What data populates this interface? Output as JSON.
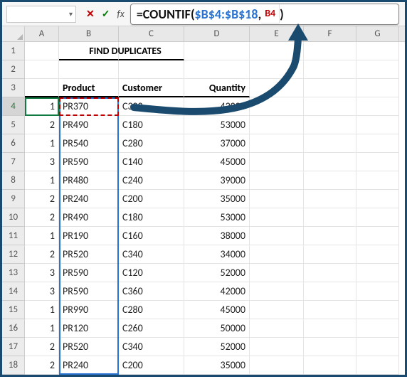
{
  "formula_bar": {
    "name_box_value": "",
    "cancel_glyph": "✕",
    "enter_glyph": "✓",
    "fx_label": "fx",
    "eq_fn": "=COUNTIF",
    "open_paren": "(",
    "range": "$B$4:$B$18",
    "comma": ", ",
    "cell_ref": "B4",
    "close_paren": ")"
  },
  "columns": {
    "A": "A",
    "B": "B",
    "C": "C",
    "D": "D",
    "E": "E",
    "F": "F",
    "G": "G"
  },
  "rownums": [
    "1",
    "2",
    "3",
    "4",
    "5",
    "6",
    "7",
    "8",
    "9",
    "10",
    "11",
    "12",
    "13",
    "14",
    "15",
    "16",
    "17",
    "18"
  ],
  "title": "FIND DUPLICATES",
  "headers": {
    "b": "Product",
    "c": "Customer",
    "d": "Quantity"
  },
  "rows": [
    {
      "a": "1",
      "b": "PR370",
      "c": "C300",
      "d": "43000"
    },
    {
      "a": "2",
      "b": "PR490",
      "c": "C180",
      "d": "53000"
    },
    {
      "a": "1",
      "b": "PR540",
      "c": "C280",
      "d": "37000"
    },
    {
      "a": "3",
      "b": "PR590",
      "c": "C140",
      "d": "45000"
    },
    {
      "a": "1",
      "b": "PR480",
      "c": "C240",
      "d": "39000"
    },
    {
      "a": "2",
      "b": "PR240",
      "c": "C200",
      "d": "35000"
    },
    {
      "a": "2",
      "b": "PR490",
      "c": "C180",
      "d": "53000"
    },
    {
      "a": "1",
      "b": "PR190",
      "c": "C160",
      "d": "38000"
    },
    {
      "a": "2",
      "b": "PR520",
      "c": "C340",
      "d": "34000"
    },
    {
      "a": "3",
      "b": "PR590",
      "c": "C120",
      "d": "52000"
    },
    {
      "a": "3",
      "b": "PR590",
      "c": "C360",
      "d": "42000"
    },
    {
      "a": "1",
      "b": "PR990",
      "c": "C280",
      "d": "45000"
    },
    {
      "a": "1",
      "b": "PR120",
      "c": "C260",
      "d": "50000"
    },
    {
      "a": "2",
      "b": "PR520",
      "c": "C340",
      "d": "52000"
    },
    {
      "a": "2",
      "b": "PR240",
      "c": "C200",
      "d": "35000"
    }
  ]
}
